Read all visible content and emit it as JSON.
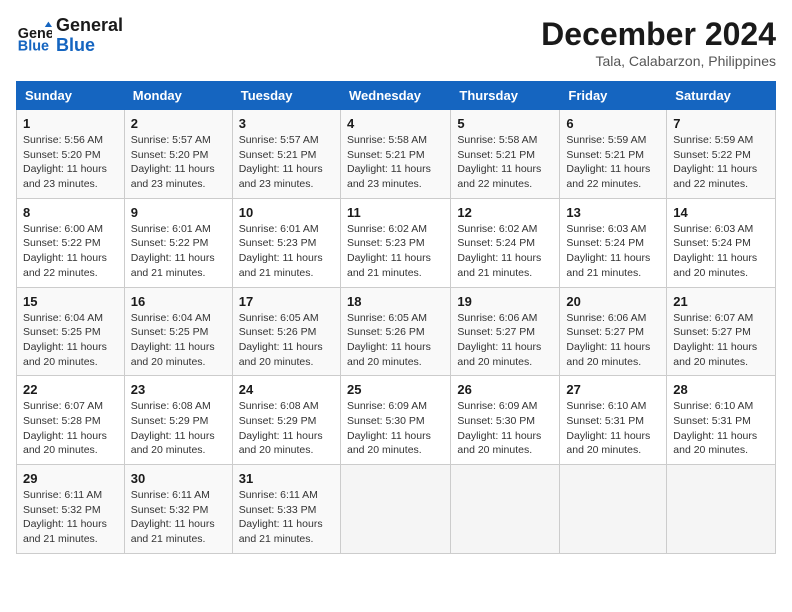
{
  "logo": {
    "text_general": "General",
    "text_blue": "Blue"
  },
  "title": "December 2024",
  "subtitle": "Tala, Calabarzon, Philippines",
  "days_of_week": [
    "Sunday",
    "Monday",
    "Tuesday",
    "Wednesday",
    "Thursday",
    "Friday",
    "Saturday"
  ],
  "weeks": [
    [
      {
        "day": "1",
        "info": "Sunrise: 5:56 AM\nSunset: 5:20 PM\nDaylight: 11 hours\nand 23 minutes."
      },
      {
        "day": "2",
        "info": "Sunrise: 5:57 AM\nSunset: 5:20 PM\nDaylight: 11 hours\nand 23 minutes."
      },
      {
        "day": "3",
        "info": "Sunrise: 5:57 AM\nSunset: 5:21 PM\nDaylight: 11 hours\nand 23 minutes."
      },
      {
        "day": "4",
        "info": "Sunrise: 5:58 AM\nSunset: 5:21 PM\nDaylight: 11 hours\nand 23 minutes."
      },
      {
        "day": "5",
        "info": "Sunrise: 5:58 AM\nSunset: 5:21 PM\nDaylight: 11 hours\nand 22 minutes."
      },
      {
        "day": "6",
        "info": "Sunrise: 5:59 AM\nSunset: 5:21 PM\nDaylight: 11 hours\nand 22 minutes."
      },
      {
        "day": "7",
        "info": "Sunrise: 5:59 AM\nSunset: 5:22 PM\nDaylight: 11 hours\nand 22 minutes."
      }
    ],
    [
      {
        "day": "8",
        "info": "Sunrise: 6:00 AM\nSunset: 5:22 PM\nDaylight: 11 hours\nand 22 minutes."
      },
      {
        "day": "9",
        "info": "Sunrise: 6:01 AM\nSunset: 5:22 PM\nDaylight: 11 hours\nand 21 minutes."
      },
      {
        "day": "10",
        "info": "Sunrise: 6:01 AM\nSunset: 5:23 PM\nDaylight: 11 hours\nand 21 minutes."
      },
      {
        "day": "11",
        "info": "Sunrise: 6:02 AM\nSunset: 5:23 PM\nDaylight: 11 hours\nand 21 minutes."
      },
      {
        "day": "12",
        "info": "Sunrise: 6:02 AM\nSunset: 5:24 PM\nDaylight: 11 hours\nand 21 minutes."
      },
      {
        "day": "13",
        "info": "Sunrise: 6:03 AM\nSunset: 5:24 PM\nDaylight: 11 hours\nand 21 minutes."
      },
      {
        "day": "14",
        "info": "Sunrise: 6:03 AM\nSunset: 5:24 PM\nDaylight: 11 hours\nand 20 minutes."
      }
    ],
    [
      {
        "day": "15",
        "info": "Sunrise: 6:04 AM\nSunset: 5:25 PM\nDaylight: 11 hours\nand 20 minutes."
      },
      {
        "day": "16",
        "info": "Sunrise: 6:04 AM\nSunset: 5:25 PM\nDaylight: 11 hours\nand 20 minutes."
      },
      {
        "day": "17",
        "info": "Sunrise: 6:05 AM\nSunset: 5:26 PM\nDaylight: 11 hours\nand 20 minutes."
      },
      {
        "day": "18",
        "info": "Sunrise: 6:05 AM\nSunset: 5:26 PM\nDaylight: 11 hours\nand 20 minutes."
      },
      {
        "day": "19",
        "info": "Sunrise: 6:06 AM\nSunset: 5:27 PM\nDaylight: 11 hours\nand 20 minutes."
      },
      {
        "day": "20",
        "info": "Sunrise: 6:06 AM\nSunset: 5:27 PM\nDaylight: 11 hours\nand 20 minutes."
      },
      {
        "day": "21",
        "info": "Sunrise: 6:07 AM\nSunset: 5:27 PM\nDaylight: 11 hours\nand 20 minutes."
      }
    ],
    [
      {
        "day": "22",
        "info": "Sunrise: 6:07 AM\nSunset: 5:28 PM\nDaylight: 11 hours\nand 20 minutes."
      },
      {
        "day": "23",
        "info": "Sunrise: 6:08 AM\nSunset: 5:29 PM\nDaylight: 11 hours\nand 20 minutes."
      },
      {
        "day": "24",
        "info": "Sunrise: 6:08 AM\nSunset: 5:29 PM\nDaylight: 11 hours\nand 20 minutes."
      },
      {
        "day": "25",
        "info": "Sunrise: 6:09 AM\nSunset: 5:30 PM\nDaylight: 11 hours\nand 20 minutes."
      },
      {
        "day": "26",
        "info": "Sunrise: 6:09 AM\nSunset: 5:30 PM\nDaylight: 11 hours\nand 20 minutes."
      },
      {
        "day": "27",
        "info": "Sunrise: 6:10 AM\nSunset: 5:31 PM\nDaylight: 11 hours\nand 20 minutes."
      },
      {
        "day": "28",
        "info": "Sunrise: 6:10 AM\nSunset: 5:31 PM\nDaylight: 11 hours\nand 20 minutes."
      }
    ],
    [
      {
        "day": "29",
        "info": "Sunrise: 6:11 AM\nSunset: 5:32 PM\nDaylight: 11 hours\nand 21 minutes."
      },
      {
        "day": "30",
        "info": "Sunrise: 6:11 AM\nSunset: 5:32 PM\nDaylight: 11 hours\nand 21 minutes."
      },
      {
        "day": "31",
        "info": "Sunrise: 6:11 AM\nSunset: 5:33 PM\nDaylight: 11 hours\nand 21 minutes."
      },
      {
        "day": "",
        "info": ""
      },
      {
        "day": "",
        "info": ""
      },
      {
        "day": "",
        "info": ""
      },
      {
        "day": "",
        "info": ""
      }
    ]
  ]
}
